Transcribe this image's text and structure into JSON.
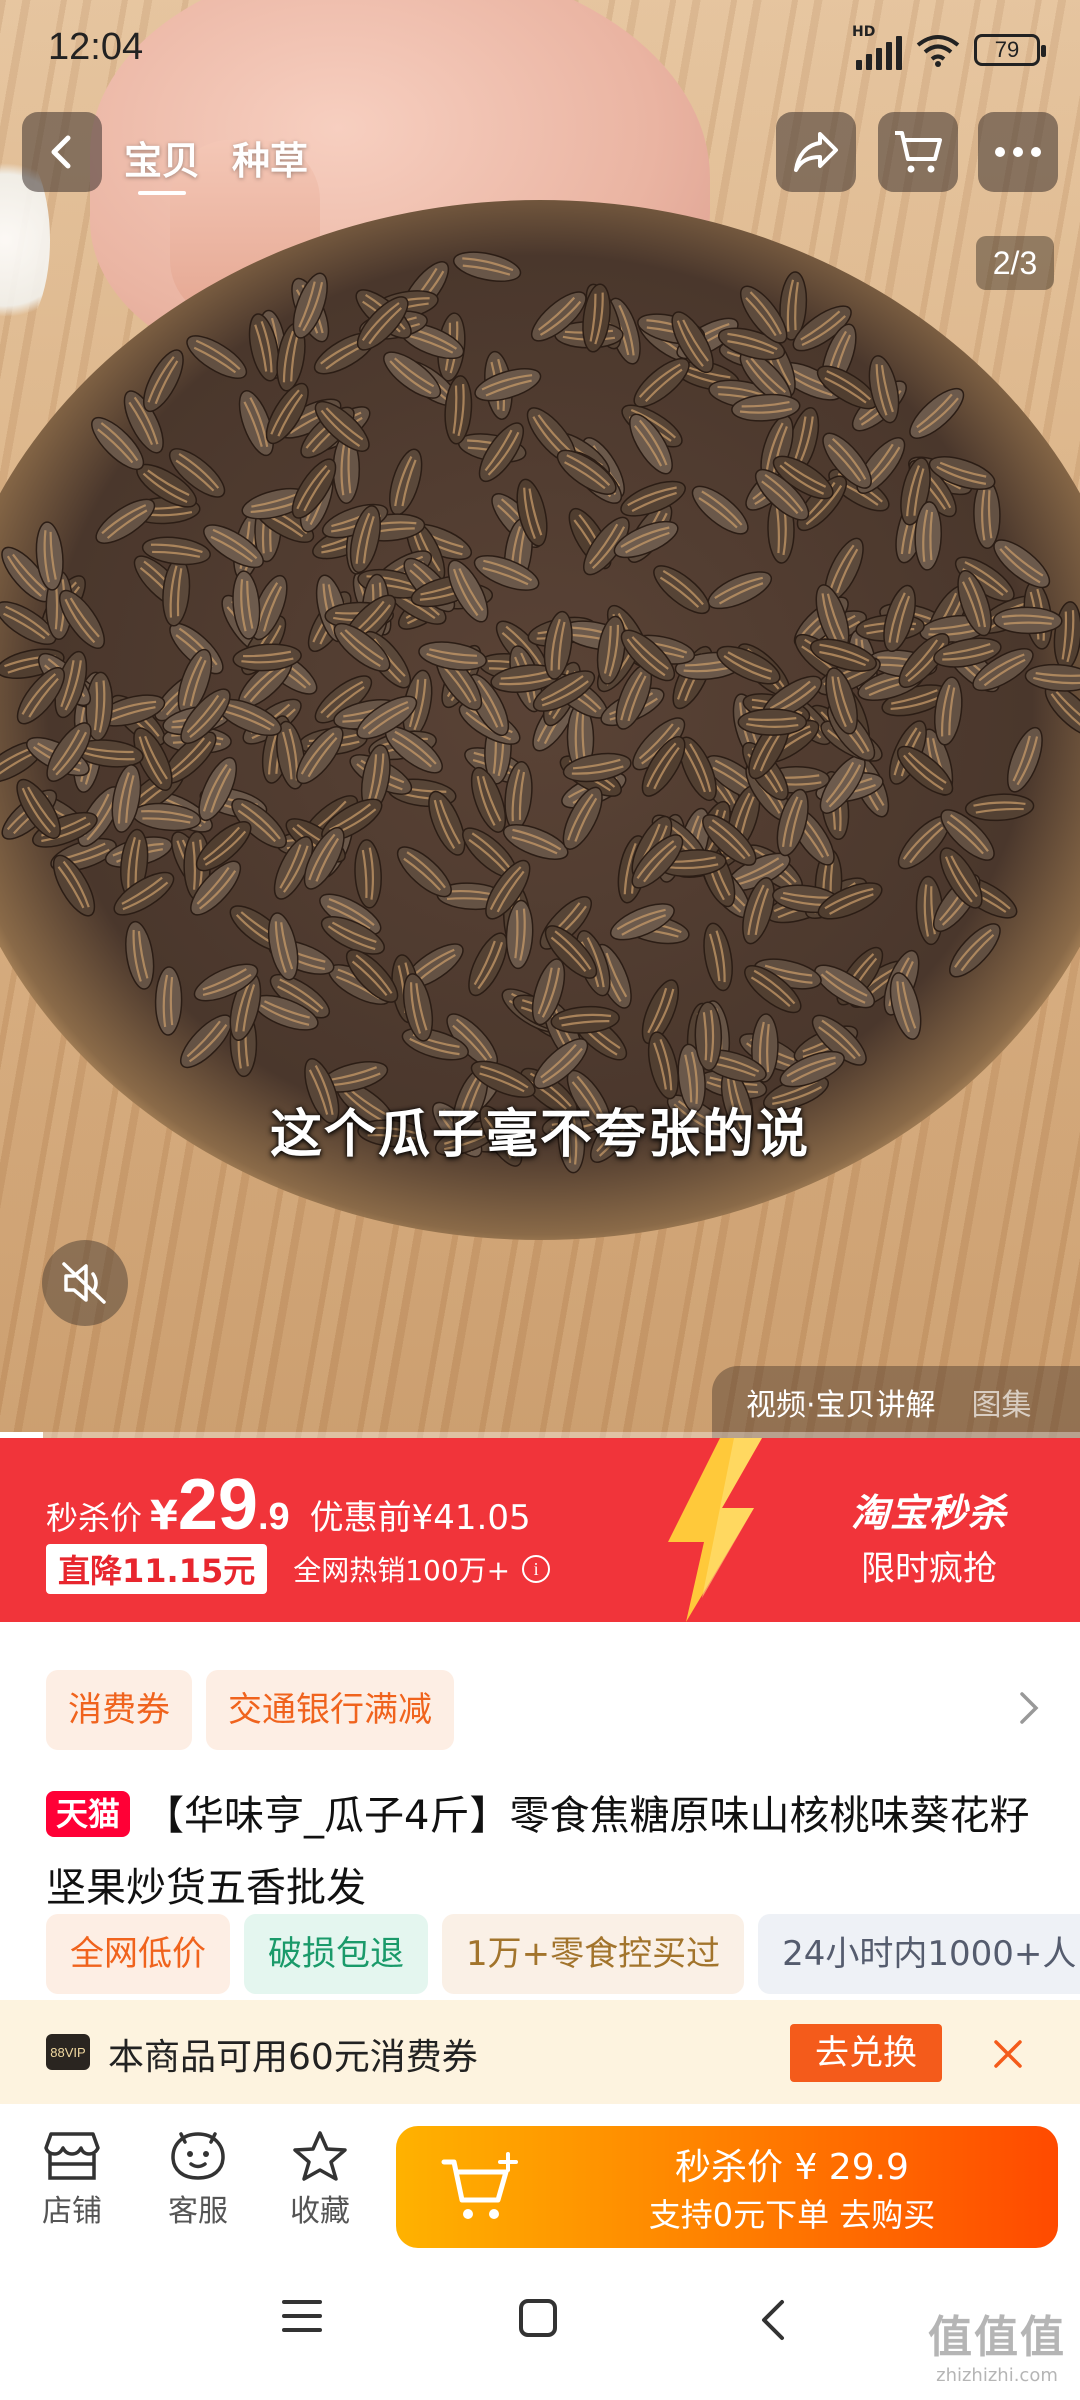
{
  "status_bar": {
    "time": "12:04",
    "network": "HD",
    "battery": "79"
  },
  "nav": {
    "tabs": [
      {
        "label": "宝贝"
      },
      {
        "label": "种草"
      }
    ]
  },
  "media": {
    "page_indicator": "2/3",
    "subtitle": "这个瓜子毫不夸张的说",
    "tab_video": "视频·宝贝讲解",
    "tab_gallery": "图集",
    "progress": 0.04
  },
  "price": {
    "label": "秒杀价",
    "currency": "¥",
    "integer": "29",
    "decimal": ".9",
    "original": "优惠前¥41.05",
    "drop_tag": "直降11.15元",
    "hot_sales": "全网热销100万+",
    "info_glyph": "i",
    "brand": "淘宝秒杀",
    "brand_sub": "限时疯抢"
  },
  "coupons": [
    {
      "label": "消费券"
    },
    {
      "label": "交通银行满减"
    }
  ],
  "product": {
    "store_badge": "天猫",
    "title": "【华味亨_瓜子4斤】零食焦糖原味山核桃味葵花籽坚果炒货五香批发"
  },
  "tags": [
    {
      "label": "全网低价"
    },
    {
      "label": "破损包退"
    },
    {
      "label": "1万+零食控买过"
    },
    {
      "label": "24小时内1000+人"
    }
  ],
  "vip": {
    "badge": "88VIP",
    "text": "本商品可用60元消费券",
    "button": "去兑换"
  },
  "actionbar": {
    "items": [
      {
        "label": "店铺"
      },
      {
        "label": "客服"
      },
      {
        "label": "收藏"
      }
    ],
    "buy_line1": "秒杀价 ¥ 29.9",
    "buy_line2": "支持0元下单  去购买"
  },
  "watermark": {
    "big": "值值值",
    "small": "zhizhizhi.com"
  },
  "colors": {
    "accent_red": "#f1343a",
    "orange": "#ff8a00",
    "tmall_red": "#ff0036"
  },
  "icons": [
    "back-icon",
    "share-icon",
    "cart-icon",
    "more-icon",
    "mute-icon",
    "info-icon",
    "chevron-right-icon",
    "close-icon",
    "store-icon",
    "service-icon",
    "star-icon",
    "add-cart-icon",
    "menu-icon",
    "home-icon",
    "back-nav-icon"
  ]
}
